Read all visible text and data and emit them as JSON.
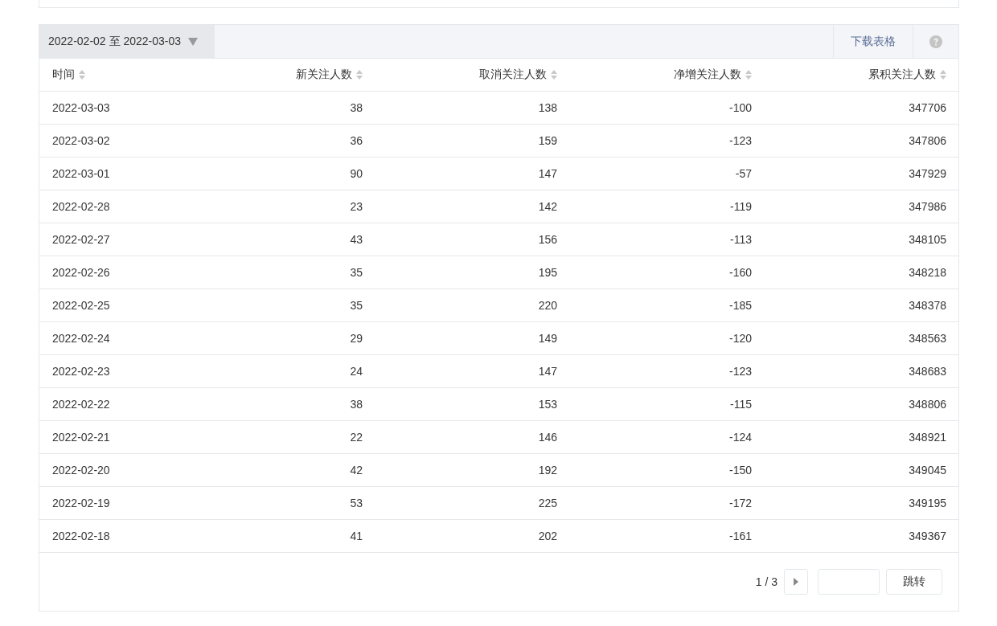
{
  "date_range": {
    "label": "2022-02-02 至 2022-03-03"
  },
  "toolbar": {
    "download": "下载表格"
  },
  "table": {
    "columns": [
      "时间",
      "新关注人数",
      "取消关注人数",
      "净增关注人数",
      "累积关注人数"
    ],
    "rows": [
      [
        "2022-03-03",
        "38",
        "138",
        "-100",
        "347706"
      ],
      [
        "2022-03-02",
        "36",
        "159",
        "-123",
        "347806"
      ],
      [
        "2022-03-01",
        "90",
        "147",
        "-57",
        "347929"
      ],
      [
        "2022-02-28",
        "23",
        "142",
        "-119",
        "347986"
      ],
      [
        "2022-02-27",
        "43",
        "156",
        "-113",
        "348105"
      ],
      [
        "2022-02-26",
        "35",
        "195",
        "-160",
        "348218"
      ],
      [
        "2022-02-25",
        "35",
        "220",
        "-185",
        "348378"
      ],
      [
        "2022-02-24",
        "29",
        "149",
        "-120",
        "348563"
      ],
      [
        "2022-02-23",
        "24",
        "147",
        "-123",
        "348683"
      ],
      [
        "2022-02-22",
        "38",
        "153",
        "-115",
        "348806"
      ],
      [
        "2022-02-21",
        "22",
        "146",
        "-124",
        "348921"
      ],
      [
        "2022-02-20",
        "42",
        "192",
        "-150",
        "349045"
      ],
      [
        "2022-02-19",
        "53",
        "225",
        "-172",
        "349195"
      ],
      [
        "2022-02-18",
        "41",
        "202",
        "-161",
        "349367"
      ]
    ]
  },
  "pagination": {
    "page": "1 / 3",
    "jump": "跳转"
  }
}
